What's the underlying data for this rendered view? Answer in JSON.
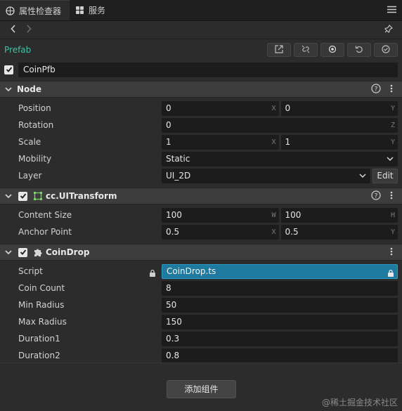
{
  "tabs": [
    {
      "label": "属性检查器",
      "icon": "inspector-icon",
      "active": true
    },
    {
      "label": "服务",
      "icon": "services-icon",
      "active": false
    }
  ],
  "prefab": {
    "label": "Prefab",
    "buttons": [
      "edit-prefab-icon",
      "unlink-icon",
      "locate-icon",
      "revert-icon",
      "apply-icon"
    ]
  },
  "node_name": "CoinPfb",
  "node_section": {
    "title": "Node",
    "position": {
      "label": "Position",
      "x": "0",
      "y": "0",
      "ax": "X",
      "ay": "Y"
    },
    "rotation": {
      "label": "Rotation",
      "z": "0",
      "az": "Z"
    },
    "scale": {
      "label": "Scale",
      "x": "1",
      "y": "1",
      "ax": "X",
      "ay": "Y"
    },
    "mobility": {
      "label": "Mobility",
      "value": "Static"
    },
    "layer": {
      "label": "Layer",
      "value": "UI_2D",
      "edit": "Edit"
    }
  },
  "uitransform": {
    "title": "cc.UITransform",
    "content_size": {
      "label": "Content Size",
      "w": "100",
      "h": "100",
      "aw": "W",
      "ah": "H"
    },
    "anchor_point": {
      "label": "Anchor Point",
      "x": "0.5",
      "y": "0.5",
      "ax": "X",
      "ay": "Y"
    }
  },
  "coindrop": {
    "title": "CoinDrop",
    "script": {
      "label": "Script",
      "value": "CoinDrop.ts"
    },
    "props": [
      {
        "label": "Coin Count",
        "value": "8"
      },
      {
        "label": "Min Radius",
        "value": "50"
      },
      {
        "label": "Max Radius",
        "value": "150"
      },
      {
        "label": "Duration1",
        "value": "0.3"
      },
      {
        "label": "Duration2",
        "value": "0.8"
      }
    ]
  },
  "add_component": "添加组件",
  "watermark": "@稀土掘金技术社区",
  "colors": {
    "prefab_label": "#3fc3a3",
    "asset_bg": "#1f7a9f",
    "panel_bg": "#2c2c2c"
  }
}
